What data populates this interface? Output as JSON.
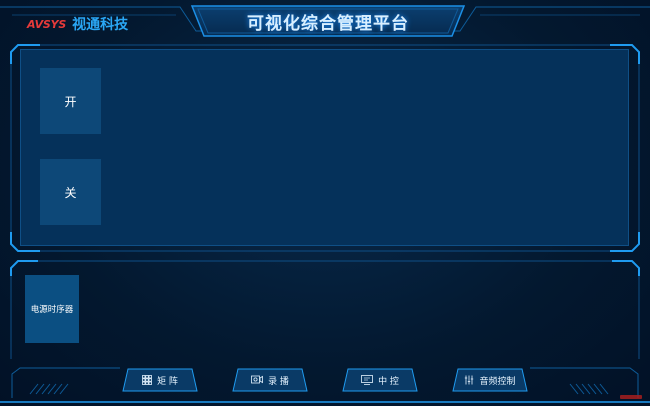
{
  "brand": {
    "mark": "AVSYS",
    "name": "视通科技"
  },
  "title": "可视化综合管理平台",
  "controls": {
    "open_label": "开",
    "close_label": "关"
  },
  "devices": {
    "sequencer_label": "电源时序器"
  },
  "nav": {
    "matrix_label": "矩 阵",
    "record_label": "录 播",
    "central_label": "中 控",
    "audio_label": "音频控制"
  },
  "colors": {
    "background": "#03182f",
    "panel": "#05315a",
    "tile": "#0d4878",
    "accent": "#1b8fe6",
    "title_glow": "#1c8fff",
    "brand_red": "#e53a3a",
    "brand_blue": "#2aa7f5"
  },
  "icons": {
    "matrix": "grid-icon",
    "record": "record-camera-icon",
    "central": "monitor-icon",
    "audio": "mixer-sliders-icon"
  }
}
